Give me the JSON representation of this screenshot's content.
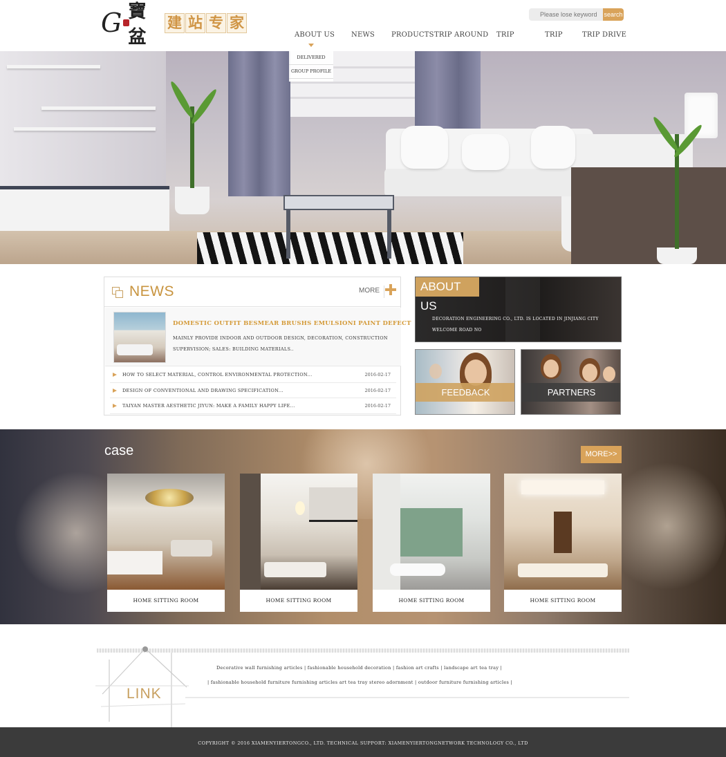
{
  "header": {
    "logo_letter": "G",
    "logo_cn_main": "寶盆",
    "logo_cn_tags": [
      "建",
      "站",
      "专",
      "家"
    ],
    "search": {
      "placeholder": "Please lose keyword",
      "button_label": "search"
    },
    "nav": [
      {
        "label": "ABOUT US",
        "active": true
      },
      {
        "label": "NEWS"
      },
      {
        "label": "PRODUCTS"
      },
      {
        "label": "TRIP AROUND"
      },
      {
        "label": "TRIP"
      },
      {
        "label": "TRIP"
      },
      {
        "label": "TRIP DRIVE"
      }
    ],
    "dropdown": [
      "DELIVERED",
      "GROUP PROFILE"
    ]
  },
  "news": {
    "title": "NEWS",
    "more_label": "MORE",
    "feature": {
      "title": "DOMESTIC OUTFIT BESMEAR BRUSHS EMULSIONI PAINT DEFECT",
      "desc": "MAINLY PROVIDE INDOOR AND OUTDOOR DESIGN, DECORATION, CONSTRUCTION SUPERVISION; SALES: BUILDING MATERIALS.."
    },
    "items": [
      {
        "title": "HOW TO SELECT MATERIAL, CONTROL ENVIRONMENTAL PROTECTION...",
        "date": "2016-02-17"
      },
      {
        "title": "DESIGN OF CONVENTIONAL AND DRAWING SPECIFICATION...",
        "date": "2016-02-17"
      },
      {
        "title": "TAIYAN MASTER AESTHETIC JIYUN: MAKE A FAMILY HAPPY LIFE...",
        "date": "2016-02-17"
      }
    ]
  },
  "about": {
    "title": "ABOUT US",
    "text": "DECORATION ENGINEERING CO., LTD. IS LOCATED IN JINJIANG CITY WELCOME ROAD NO"
  },
  "tiles": {
    "feedback": "FEEDBACK",
    "partners": "PARTNERS"
  },
  "case": {
    "title": "case",
    "more_label": "MORE>>",
    "cards": [
      {
        "label": "HOME SITTING ROOM"
      },
      {
        "label": "HOME SITTING ROOM"
      },
      {
        "label": "HOME SITTING ROOM"
      },
      {
        "label": "HOME SITTING ROOM"
      }
    ]
  },
  "links": {
    "title": "LINK",
    "row1": "Decorative wall furnishing articles | fashionable household decoration | fashion art crafts | landscape art tea tray |",
    "row2": "| fashionable household furniture furnishing articles art tea tray stereo adornment | outdoor furniture furnishing articles |"
  },
  "footer": {
    "text": "COPYRIGHT © 2016 XIAMENYIERTONGCO., LTD. TECHNICAL SUPPORT: XIAMENYIERTONGNETWORK TECHNOLOGY CO., LTD"
  },
  "colors": {
    "accent": "#d9a35a",
    "news_title": "#c8943f",
    "footer_bg": "#3b3b3b"
  }
}
